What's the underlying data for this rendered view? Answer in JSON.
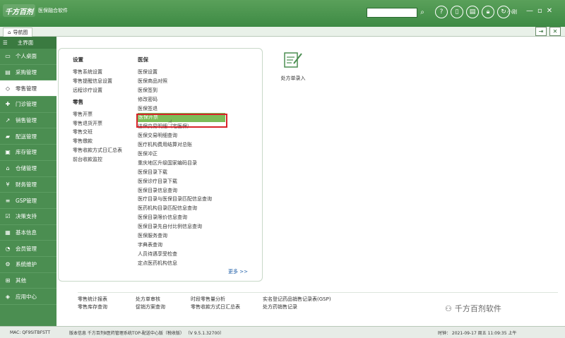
{
  "app": {
    "logo_text": "千方百剂",
    "product": "医保融合软件"
  },
  "titlebar": {
    "user": "小刚",
    "icons": [
      "help-icon",
      "phone-icon",
      "print-icon",
      "lock-icon",
      "refresh-icon"
    ]
  },
  "tabs": [
    {
      "label": "导航图"
    }
  ],
  "sidebar": {
    "header": "主界面",
    "items": [
      {
        "label": "个人桌面",
        "icon": "monitor-icon"
      },
      {
        "label": "采购管理",
        "icon": "cart-icon"
      },
      {
        "label": "零售管理",
        "icon": "tag-icon"
      },
      {
        "label": "门诊管理",
        "icon": "clinic-icon"
      },
      {
        "label": "销售管理",
        "icon": "chart-icon"
      },
      {
        "label": "配送管理",
        "icon": "truck-icon"
      },
      {
        "label": "库存管理",
        "icon": "box-icon"
      },
      {
        "label": "仓储管理",
        "icon": "warehouse-icon"
      },
      {
        "label": "财务管理",
        "icon": "yuan-icon"
      },
      {
        "label": "GSP管理",
        "icon": "list-icon"
      },
      {
        "label": "决策支持",
        "icon": "check-icon"
      },
      {
        "label": "基本信息",
        "icon": "card-icon"
      },
      {
        "label": "会员管理",
        "icon": "user-icon"
      },
      {
        "label": "系统维护",
        "icon": "gear-icon"
      },
      {
        "label": "其他",
        "icon": "grid-icon"
      },
      {
        "label": "应用中心",
        "icon": "cube-icon"
      }
    ]
  },
  "menu": {
    "settings": {
      "title": "设置",
      "items": [
        "零售系统设置",
        "零售提醒信息设置",
        "远程诊疗设置"
      ]
    },
    "retail": {
      "title": "零售",
      "items": [
        "零售开票",
        "零售退货开票",
        "零售交班",
        "零售缴款",
        "零售收款方式日汇总表",
        "前台收款监控"
      ]
    },
    "medical": {
      "title": "医保",
      "items": [
        "医保设置",
        "医保商品对照",
        "医保签到",
        "修改密码",
        "医保签退",
        "医保开票",
        "往保交易明细（宅医保）",
        "医保交易明细查询",
        "医疗机构费用结算对总账",
        "医保冲正",
        "重庆地区升级国家编码目录",
        "医保目录下载",
        "医保诊疗目录下载",
        "医保目录信息查询",
        "医疗目录与医保目录匹配信息查询",
        "医药机构目录匹配信息查询",
        "医保目录限价信息查询",
        "医保目录先自付比例信息查询",
        "医保服务查询",
        "字典表查询",
        "人员待遇享受检查",
        "定点医药机构信息"
      ]
    },
    "more_label": "更多 >>"
  },
  "shortcut": {
    "label": "处方单录入"
  },
  "quick_links": [
    [
      "零售统计报表",
      "零售库存查询"
    ],
    [
      "处方单审核",
      "促销方案查询"
    ],
    [
      "时段零售量分析",
      "零售收款方式日汇总表"
    ],
    [
      "实名登记药品销售记录表(GSP)",
      "处方药销售记录"
    ]
  ],
  "watermark": "千方百剂软件",
  "status": {
    "machine": "MAC: QF9SITBFSTT",
    "version": "版本信息  千方百剂Ⅱ医药管理系统TOP-配送中心版（税收版）  （V 9.5.1.32700）",
    "time": "时钟： 2021-09-17 周五 11:09:35 上午"
  }
}
